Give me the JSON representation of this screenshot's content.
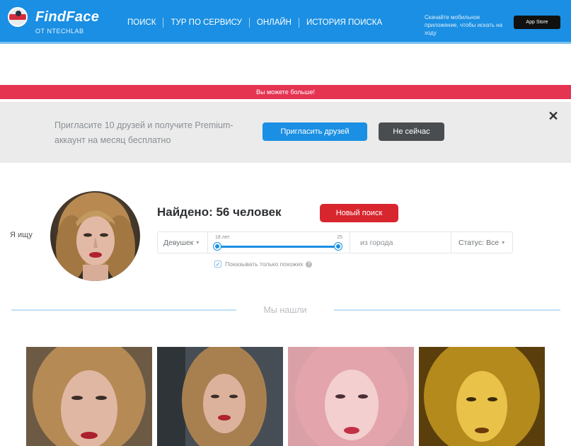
{
  "header": {
    "brand": "FindFace",
    "brand_sub": "ОТ NTECHLAB",
    "nav": [
      "поиск",
      "тур по сервису",
      "онлайн",
      "история поиска"
    ],
    "promo_text": "Скачайте мобильное приложение, чтобы искать на ходу",
    "store_label": "App Store"
  },
  "alert": {
    "text": "Вы можете больше!"
  },
  "invite": {
    "text": "Пригласите 10 друзей и получите Premium-аккаунт на месяц бесплатно",
    "invite_button": "Пригласить друзей",
    "dismiss_button": "Не сейчас",
    "close_symbol": "✕"
  },
  "search": {
    "photo_label": "Я ищу",
    "result_title": "Найдено: 56 человек",
    "new_search_button": "Новый поиск",
    "gender_filter": "Девушек",
    "age_min": "18 лет",
    "age_max": "25",
    "city_placeholder": "из города",
    "status_filter": "Статус: Все",
    "checkbox_label": "Показывать только похожих",
    "checkbox_checked": true
  },
  "divider": {
    "text": "Мы нашли"
  },
  "colors": {
    "header": "#1a8fe3",
    "alert": "#e53352",
    "new_search": "#d8262f",
    "dismiss": "#4a4d50"
  }
}
